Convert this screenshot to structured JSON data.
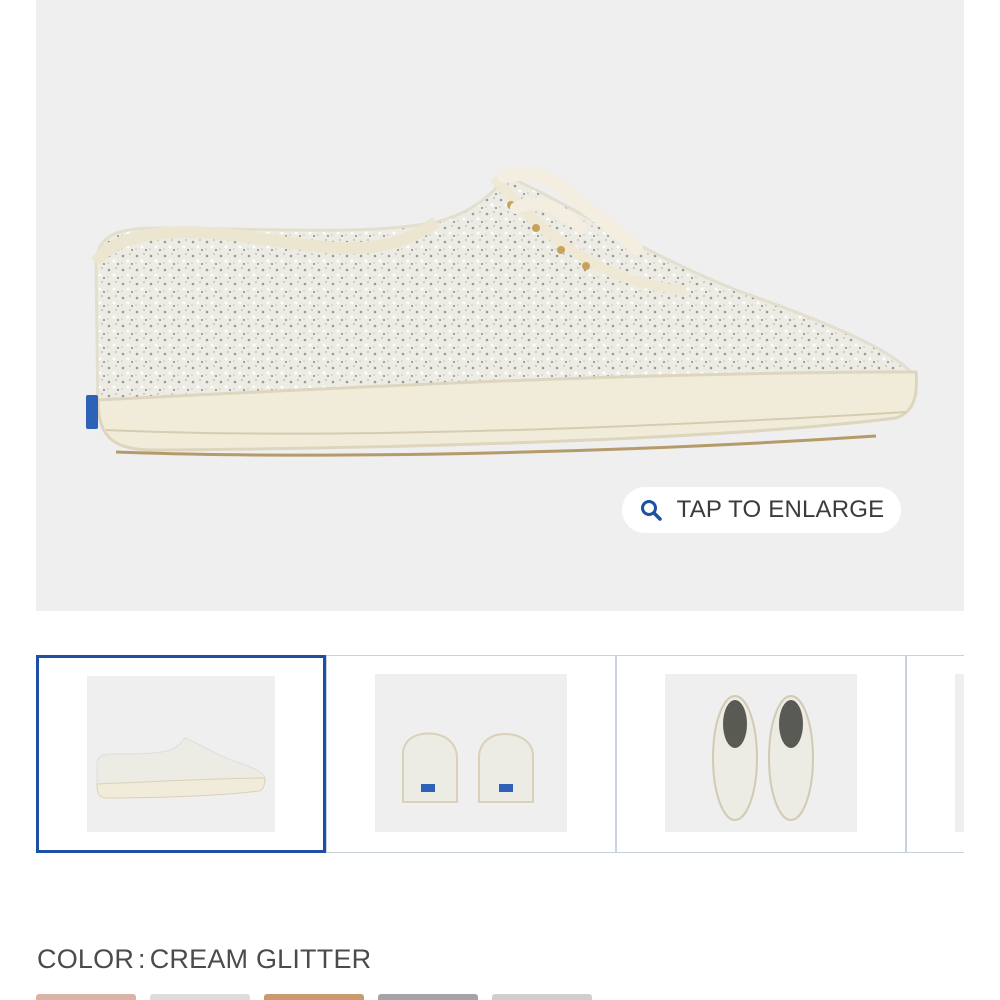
{
  "hero": {
    "enlarge_label": "TAP TO ENLARGE",
    "enlarge_icon": "magnifier-icon"
  },
  "thumbnails": [
    {
      "view": "side",
      "selected": true
    },
    {
      "view": "back",
      "selected": false
    },
    {
      "view": "top",
      "selected": false
    },
    {
      "view": "partial",
      "selected": false
    }
  ],
  "color": {
    "label": "COLOR",
    "separator": ":",
    "value": "CREAM GLITTER"
  },
  "swatches": [
    "#d9b3a8",
    "#dcdcdc",
    "#c99a6e",
    "#a4a4a8",
    "#cfcfd2"
  ],
  "colors": {
    "accent": "#1d4fa3",
    "hero_bg": "#efeff0",
    "text": "#4a4a4f"
  }
}
